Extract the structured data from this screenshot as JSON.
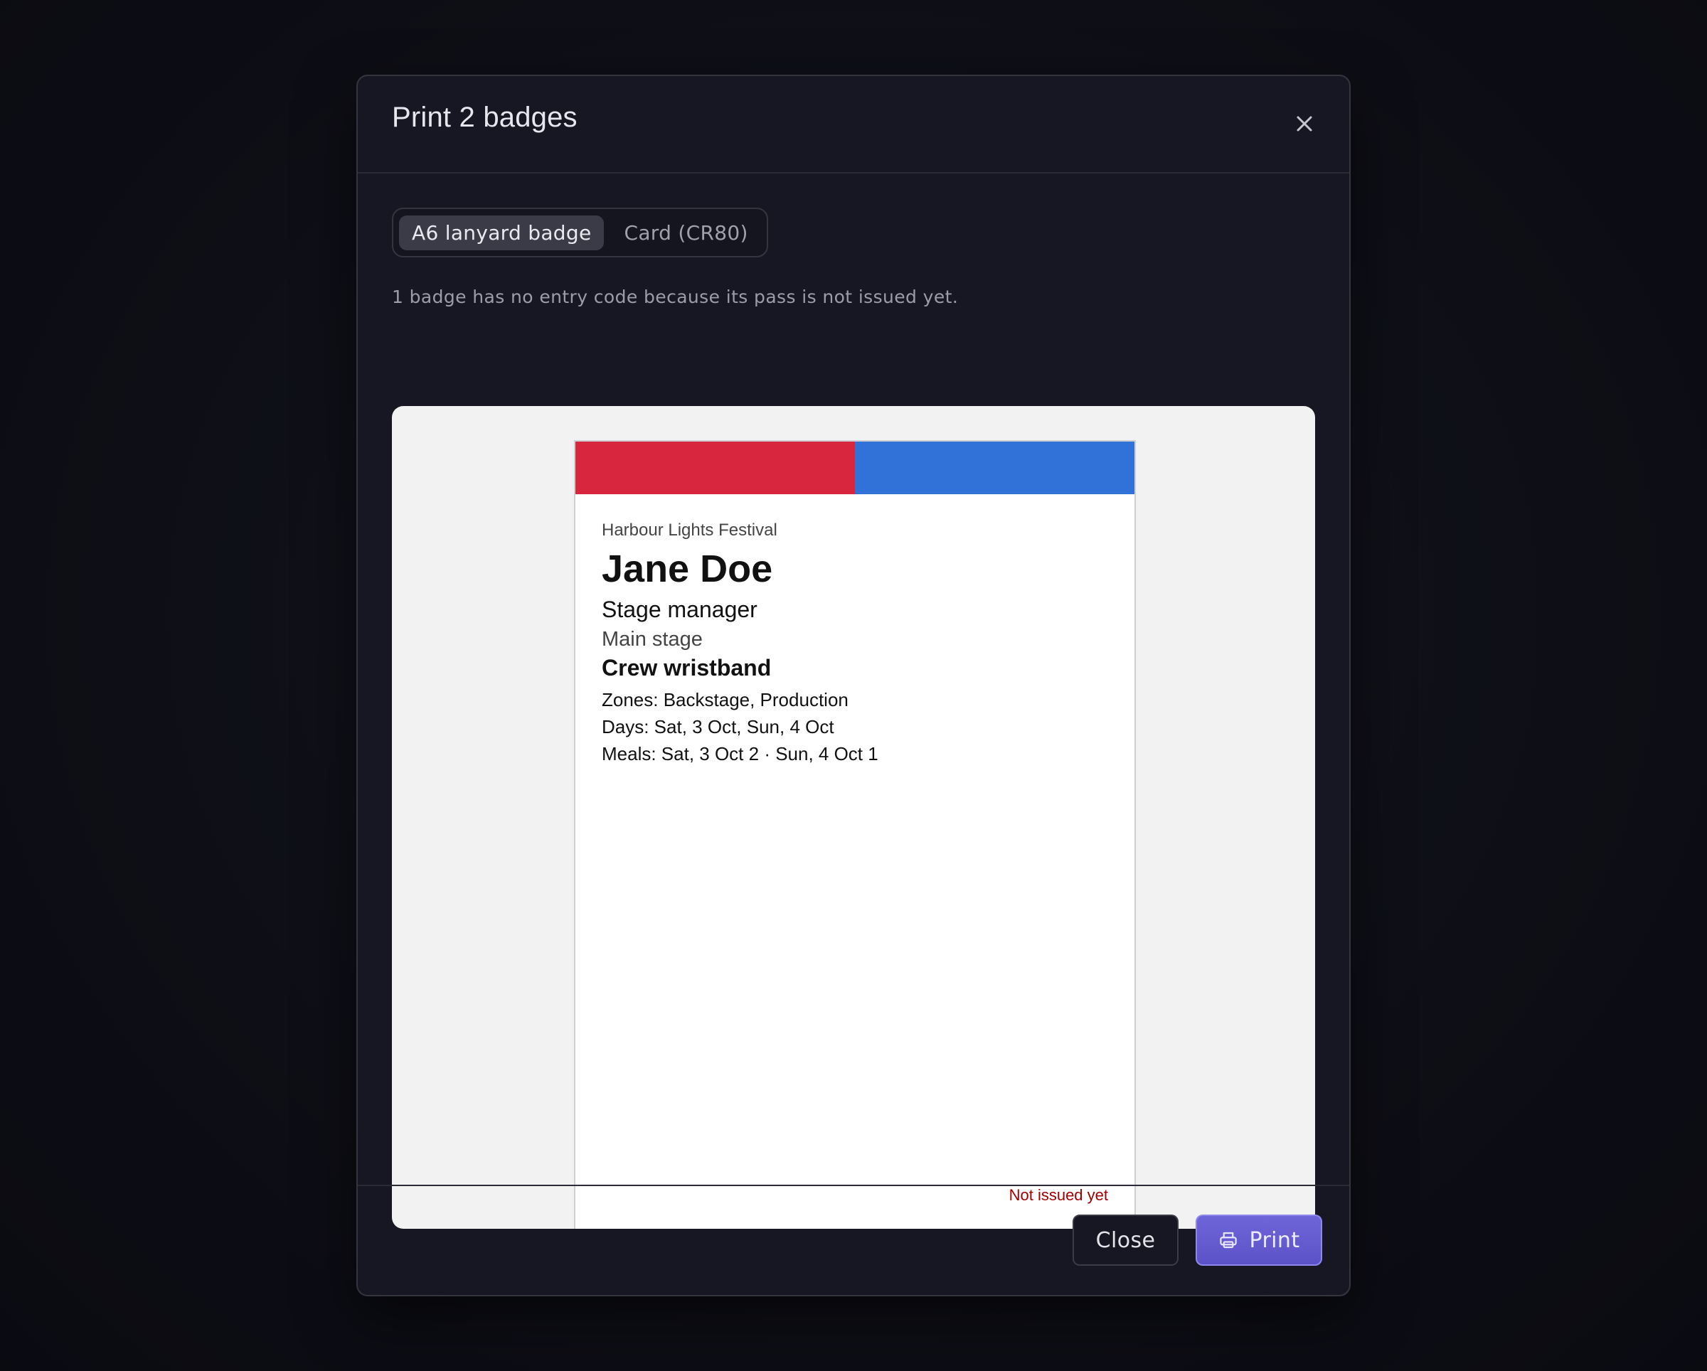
{
  "dialog": {
    "title": "Print 2 badges",
    "close_icon": "close-icon"
  },
  "format_tabs": [
    {
      "label": "A6 lanyard badge",
      "active": true
    },
    {
      "label": "Card (CR80)",
      "active": false
    }
  ],
  "note": "1 badge has no entry code because its pass is not issued yet.",
  "badge": {
    "stripe_colors": [
      "#d7263d",
      "#3172d8"
    ],
    "event_name": "Harbour Lights Festival",
    "person_name": "Jane Doe",
    "role": "Stage manager",
    "area": "Main stage",
    "pass_type": "Crew wristband",
    "zones": "Zones: Backstage, Production",
    "days": "Days: Sat, 3 Oct, Sun, 4 Oct",
    "meals": "Meals: Sat, 3 Oct 2 · Sun, 4 Oct 1",
    "status": "Not issued yet",
    "status_color": "#a00000"
  },
  "footer": {
    "close_label": "Close",
    "print_label": "Print",
    "print_icon": "printer-icon",
    "accent_color": "#6359d0"
  }
}
